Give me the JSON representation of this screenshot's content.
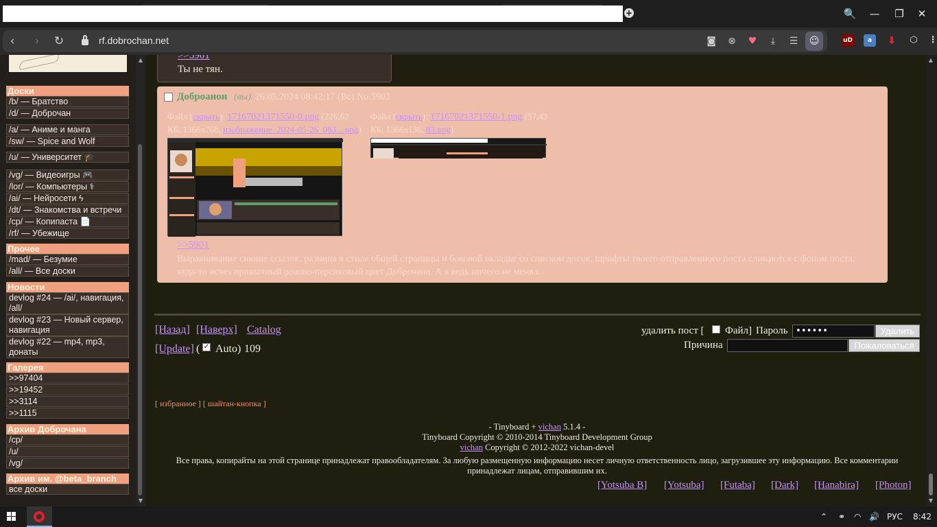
{
  "browser": {
    "url": "rf.dobrochan.net",
    "profile_icon": "profile-icon",
    "win_controls": [
      "🔍",
      "—",
      "❐",
      "✕"
    ]
  },
  "sidebar": {
    "sections": [
      {
        "title": "Доски",
        "items": [
          "/b/ — Братство",
          "/d/ — Доброчан"
        ]
      },
      {
        "title": "",
        "items": [
          "/a/ — Аниме и манга",
          "/sw/ — Spice and Wolf"
        ]
      },
      {
        "title": "",
        "items": [
          "/u/ — Университет 🎓"
        ]
      },
      {
        "title": "",
        "items": [
          "/vg/ — Видеоигры 🎮",
          "/lor/ — Компьютеры ⚕",
          "/ai/ — Нейросети ϟ",
          "/dt/ — Знакомства и встречи",
          "/cp/ — Копипаста 📄",
          "/rf/ — Убежище"
        ]
      },
      {
        "title": "Прочее",
        "items": [
          "/mad/ — Безумие",
          "/all/ — Все доски"
        ]
      },
      {
        "title": "Новости",
        "items": [
          "devlog #24 — /ai/, навигация, /all/",
          "devlog #23 — Новый сервер, навигация",
          "devlog #22 — mp4, mp3, донаты"
        ]
      },
      {
        "title": "Галерея",
        "items": [
          ">>97404",
          ">>19452",
          ">>3114",
          ">>1115"
        ]
      },
      {
        "title": "Архив Доброчана",
        "items": [
          "/cp/",
          "/u/",
          "/vg/"
        ]
      },
      {
        "title": "Архив им. @beta_branch",
        "items": [
          "все доски"
        ]
      }
    ]
  },
  "prev_post": {
    "link": ">>5901",
    "text": "Ты не тян."
  },
  "post": {
    "name": "Доброанон",
    "you": "(вы)",
    "date": "26.05.2024 08:42:17 (Вс) No.5903",
    "file1": {
      "label": "Файл (",
      "link1": "скрыть",
      "sep": "):",
      "filename": "17167021371550-0.png",
      "info": "(226,62",
      "info2": "КБ, 1366x768,",
      "original": "изображение_2024-05-26_083....png",
      "close": ")"
    },
    "file2": {
      "label": "Файл (",
      "link1": "скрыть",
      "sep": "):",
      "filename": "17167021371550-1.png",
      "info": "(57,43",
      "info2": "КБ, 1366x136,",
      "original": "83.png",
      "close": ")"
    },
    "reply_link": ">>5901",
    "body": "Выравнивание сняние ссылок, разница в стиле общей страницы и боковой вкладке со списком досок, шрифты твоего отправленного поста сливаются с фоном поста, куда-то исчез привычный розово-персиковый цвет Доброчана. А я ведь ничего не менял."
  },
  "footer_nav": {
    "back": "[Назад]",
    "top": "[Наверх]",
    "catalog": "Catalog",
    "update": "[Update]",
    "auto_open": "(",
    "auto": "Auto)",
    "count": "109"
  },
  "delete_form": {
    "label_start": "удалить пост [",
    "label_file": "Файл]",
    "password_label": "Пароль",
    "password_value": "••••••",
    "delete_button": "Удалить",
    "reason_label": "Причина",
    "report_button": "Пожаловаться"
  },
  "small_nav": {
    "open": "[",
    "favorites": "избранное",
    "mid": "] [",
    "shaitan": "шайтан-кнопка",
    "close": "]"
  },
  "credits": {
    "line1_pre": "- Tinyboard + ",
    "line1_link": "vichan",
    "line1_post": " 5.1.4 -",
    "line2": "Tinyboard Copyright © 2010-2014 Tinyboard Development Group",
    "line3_link": "vichan",
    "line3_post": " Copyright © 2012-2022 vichan-devel",
    "line4": "Все права, копирайты на этой странице принадлежат правообладателям. За любую размещенную информацию несет личную ответственность лицо, загрузившее эту информацию. Все комментарии принадлежат лицам, отправившим их."
  },
  "styles": [
    "[Yotsuba B]",
    "[Yotsuba]",
    "[Futaba]",
    "[Dark]",
    "[Hanabira]",
    "[Photon]"
  ],
  "taskbar": {
    "lang": "РУС",
    "time": "8:42"
  },
  "colors": {
    "accent": "#f0a07e",
    "post_bg": "#efbeaa",
    "link": "#c990ff",
    "name": "#5aa068"
  }
}
